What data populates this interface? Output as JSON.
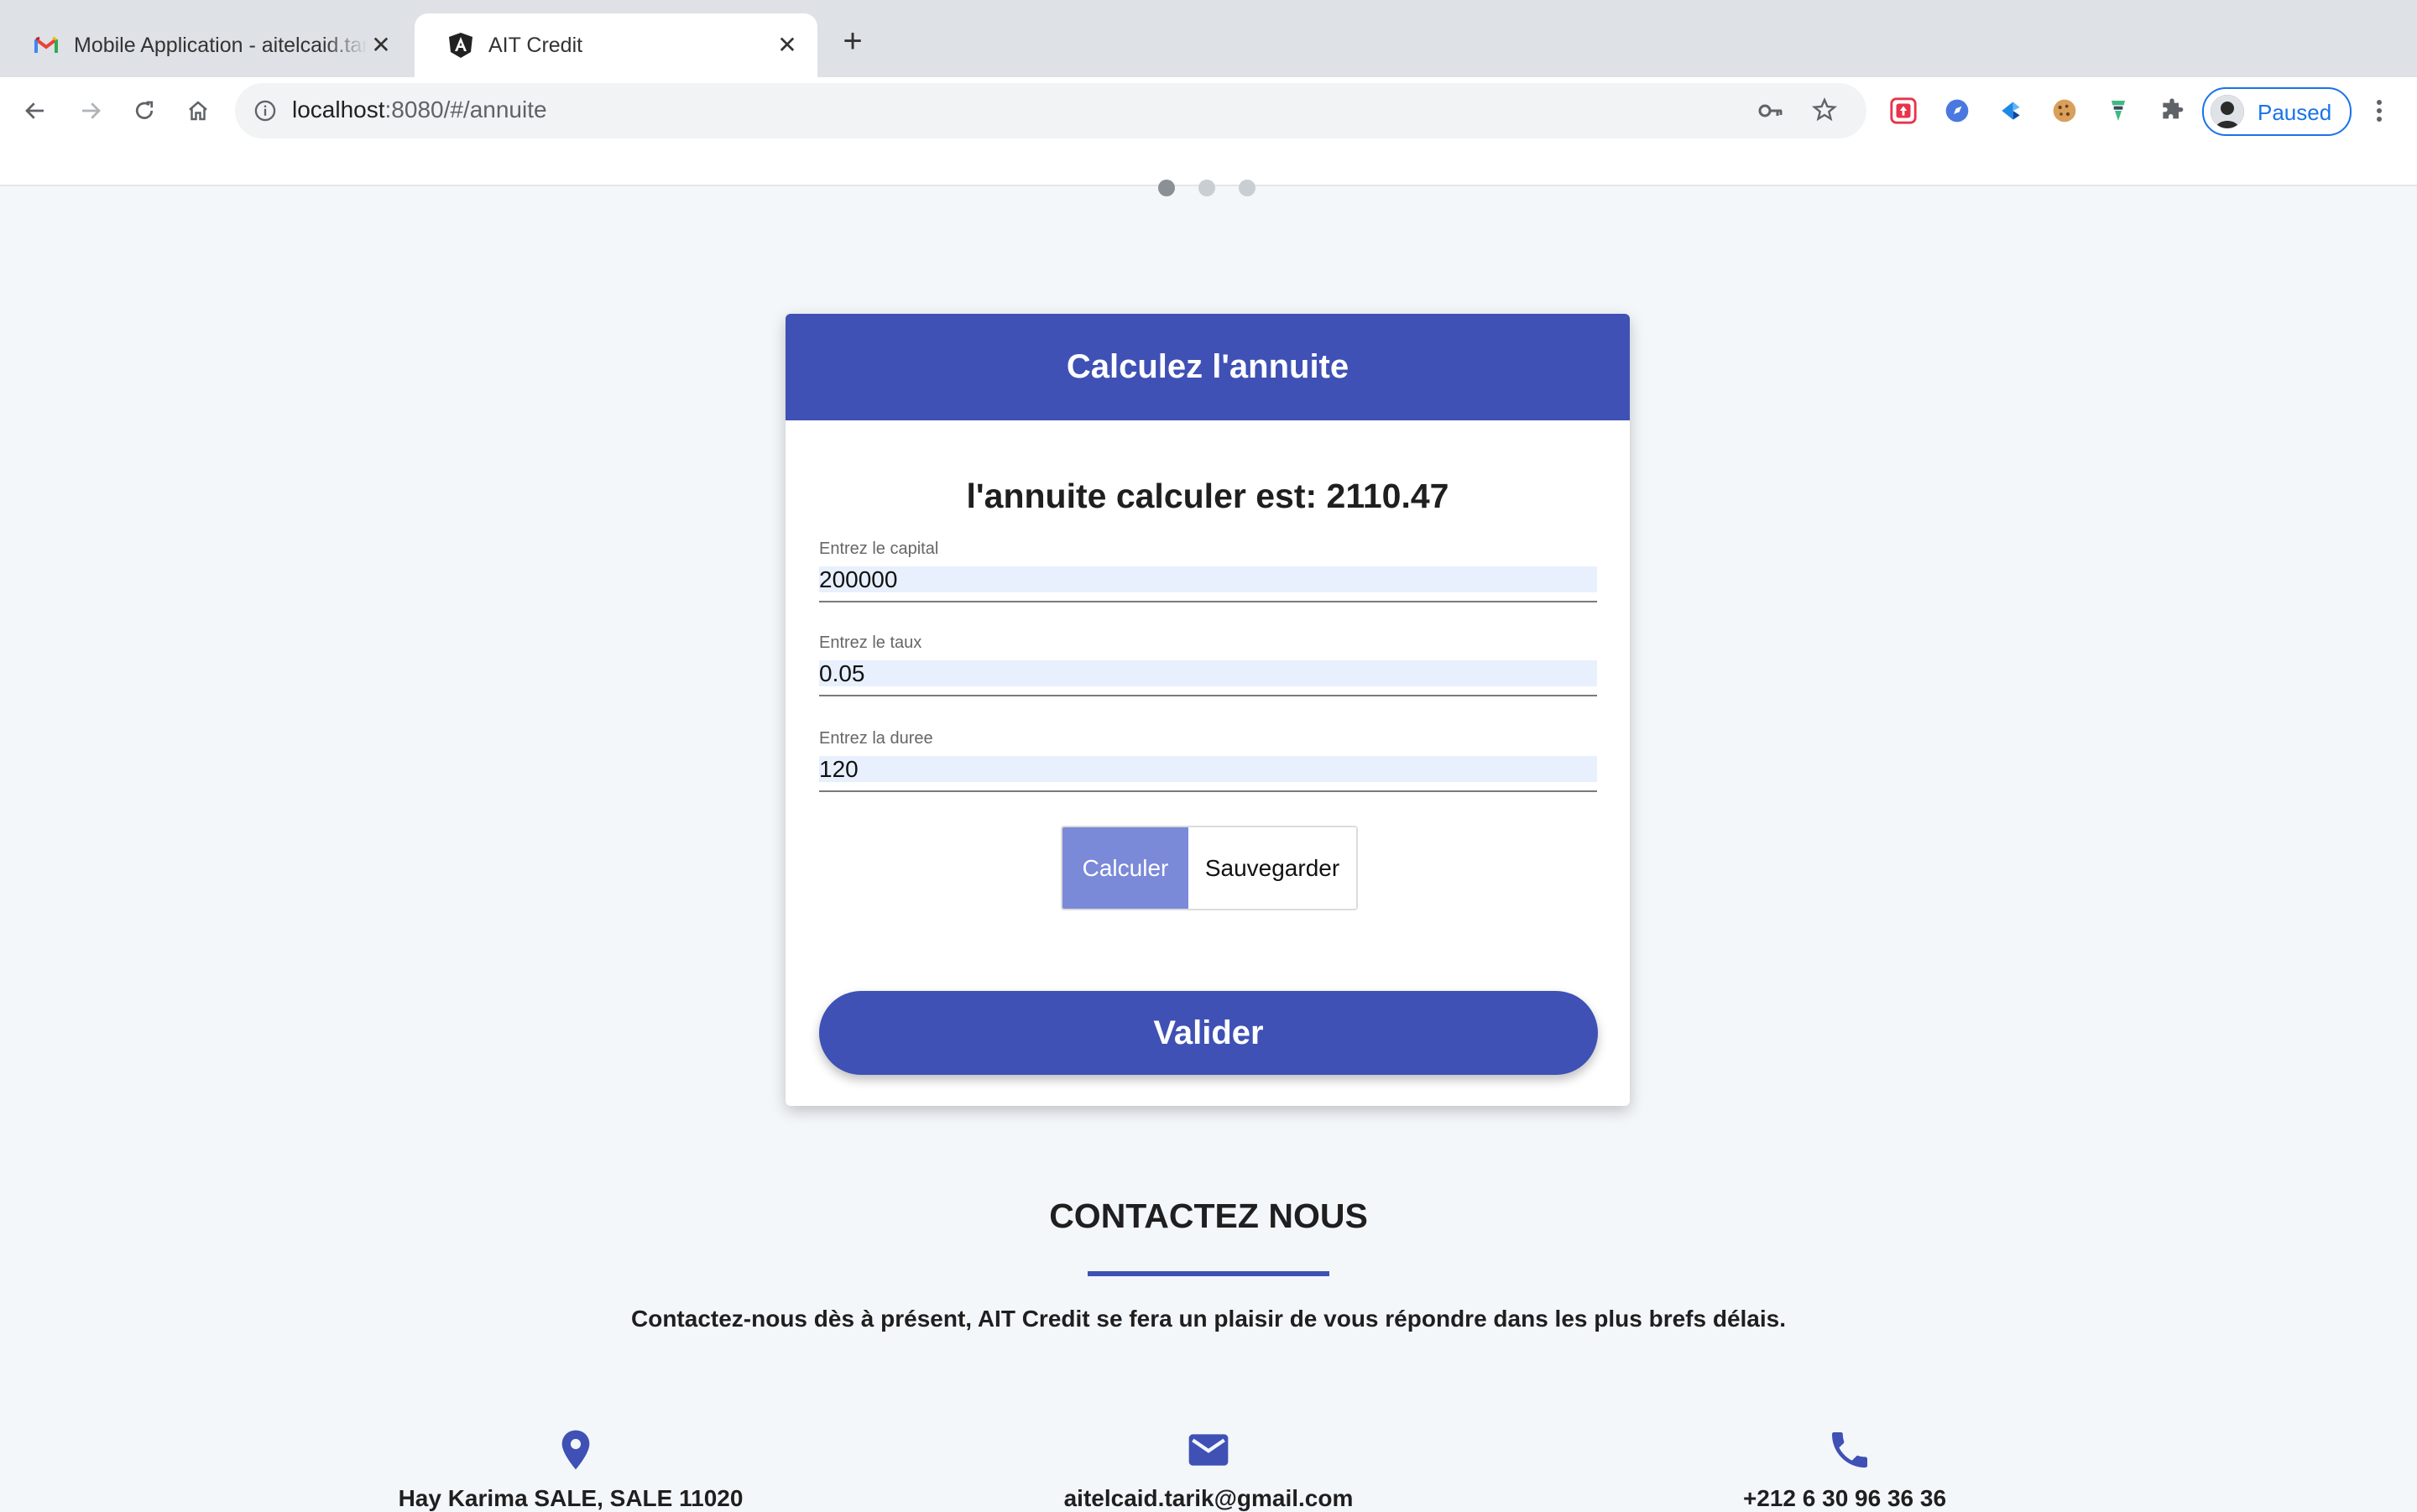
{
  "browser": {
    "tabs": [
      {
        "title": "Mobile Application - aitelcaid.tarik@gmail.com",
        "active": false,
        "icon": "gmail-icon"
      },
      {
        "title": "AIT Credit",
        "active": true,
        "icon": "angular-icon"
      }
    ],
    "url": {
      "host": "localhost",
      "path": ":8080/#/annuite"
    },
    "profile_label": "Paused"
  },
  "card": {
    "title": "Calculez l'annuite",
    "result": "l'annuite calculer est: 2110.47",
    "fields": [
      {
        "label": "Entrez le capital",
        "value": "200000"
      },
      {
        "label": "Entrez le taux",
        "value": "0.05"
      },
      {
        "label": "Entrez la duree",
        "value": "120"
      }
    ],
    "calc_label": "Calculer",
    "save_label": "Sauvegarder",
    "submit_label": "Valider"
  },
  "contact": {
    "title": "CONTACTEZ NOUS",
    "text": "Contactez-nous dès à présent, AIT Credit se fera un plaisir de vous répondre dans les plus brefs délais.",
    "items": [
      {
        "icon": "location-pin-icon",
        "text": "Hay Karima SALE, SALE 11020"
      },
      {
        "icon": "mail-icon",
        "text": "aitelcaid.tarik@gmail.com"
      },
      {
        "icon": "phone-icon",
        "text": "+212 6 30 96 36 36"
      }
    ]
  },
  "colors": {
    "primary": "#3f51b5",
    "calc_button": "#7b89d9",
    "background": "#f3f7fa"
  }
}
